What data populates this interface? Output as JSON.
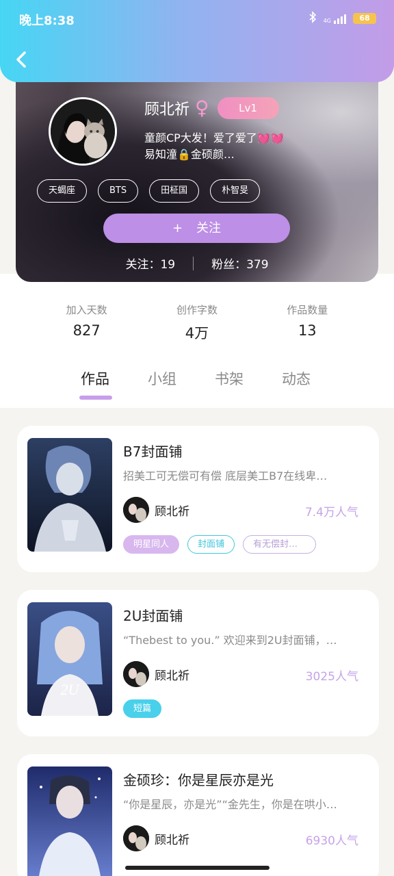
{
  "status_bar": {
    "time": "晚上8:38",
    "network": "4G",
    "battery": "68"
  },
  "profile": {
    "name": "顾北祈",
    "gender_symbol": "♀",
    "level": "Lv1",
    "bio_line1": "童颜CP大发！爱了爱了💓💓",
    "bio_line2": "易知潼🔒金硕颜…",
    "tags": [
      "天蝎座",
      "BTS",
      "田柾国",
      "朴智旻"
    ],
    "follow_plus": "+",
    "follow_label": "关注",
    "following": "关注：19",
    "fans": "粉丝：379"
  },
  "stats": [
    {
      "label": "加入天数",
      "value": "827"
    },
    {
      "label": "创作字数",
      "value": "4万"
    },
    {
      "label": "作品数量",
      "value": "13"
    }
  ],
  "tabs": [
    "作品",
    "小组",
    "书架",
    "动态"
  ],
  "books": [
    {
      "title": "B7封面铺",
      "desc": "招美工可无偿可有偿 底层美工B7在线卑…",
      "author": "顾北祈",
      "popularity": "7.4万人气",
      "tags": [
        "明星同人",
        "封面铺",
        "有无偿封…"
      ]
    },
    {
      "title": "2U封面铺",
      "desc": "“Thebest to you.” 欢迎来到2U封面铺，…",
      "author": "顾北祈",
      "popularity": "3025人气",
      "tags": [
        "短篇"
      ]
    },
    {
      "title": "金硕珍：你是星辰亦是光",
      "desc": "“你是星辰，亦是光”“金先生，你是在哄小…",
      "author": "顾北祈",
      "popularity": "6930人气",
      "tags": []
    }
  ],
  "colors": {
    "accent": "#bd8fe6",
    "header_start": "#46d6f4",
    "header_end": "#c39ce8",
    "cyan": "#49d0ea"
  }
}
